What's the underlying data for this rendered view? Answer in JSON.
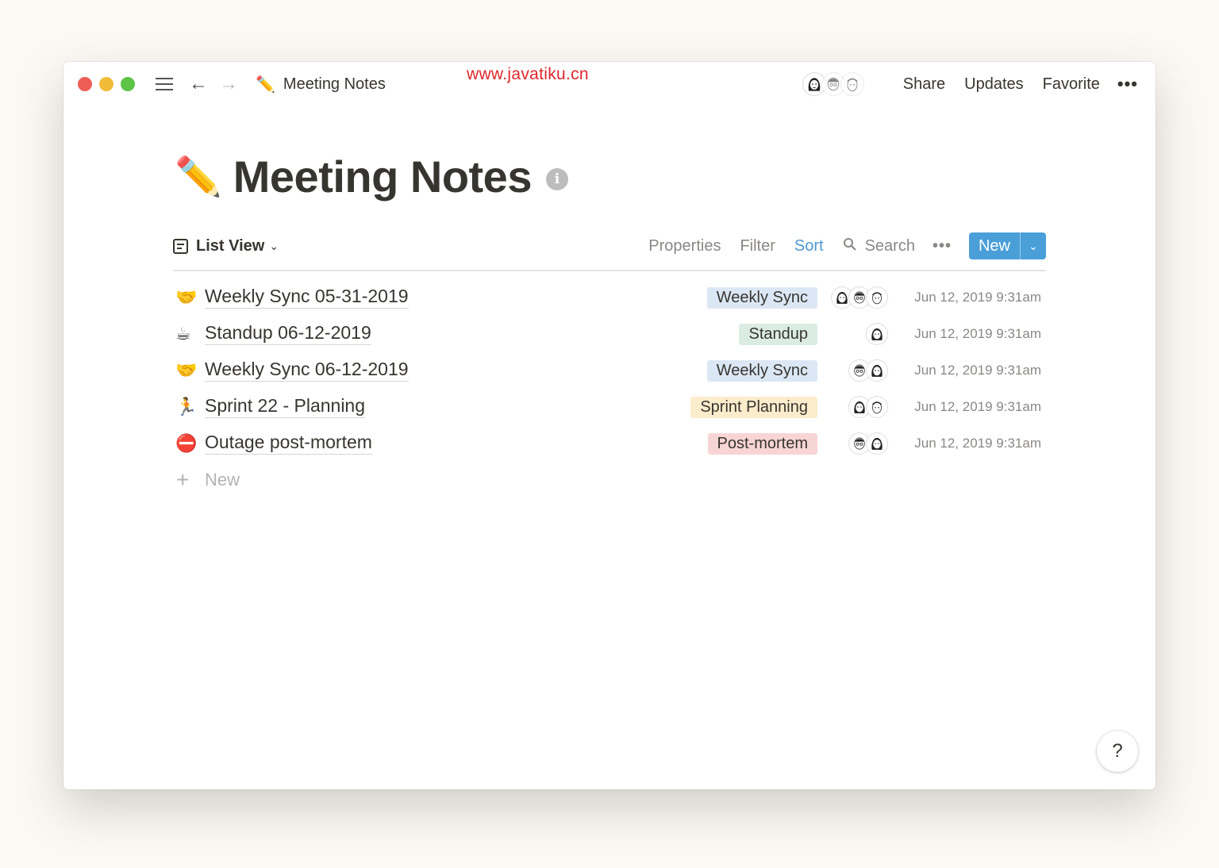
{
  "watermark": "www.javatiku.cn",
  "titlebar": {
    "page_emoji": "✏️",
    "page_name": "Meeting Notes",
    "share": "Share",
    "updates": "Updates",
    "favorite": "Favorite",
    "more": "•••"
  },
  "page": {
    "emoji": "✏️",
    "title": "Meeting Notes",
    "info": "i"
  },
  "view": {
    "name": "List View",
    "properties": "Properties",
    "filter": "Filter",
    "sort": "Sort",
    "search": "Search",
    "more": "•••",
    "new": "New"
  },
  "rows": [
    {
      "emoji": "🤝",
      "title": "Weekly Sync 05-31-2019",
      "tag": "Weekly Sync",
      "tag_color": "#dce7f5",
      "people": 3,
      "date": "Jun 12, 2019 9:31am"
    },
    {
      "emoji": "☕",
      "title": "Standup 06-12-2019",
      "tag": "Standup",
      "tag_color": "#dbece3",
      "people": 1,
      "date": "Jun 12, 2019 9:31am"
    },
    {
      "emoji": "🤝",
      "title": "Weekly Sync 06-12-2019",
      "tag": "Weekly Sync",
      "tag_color": "#dce7f5",
      "people": 2,
      "date": "Jun 12, 2019 9:31am"
    },
    {
      "emoji": "🏃",
      "title": "Sprint 22 - Planning",
      "tag": "Sprint Planning",
      "tag_color": "#fbeccc",
      "people": 2,
      "date": "Jun 12, 2019 9:31am"
    },
    {
      "emoji": "⛔",
      "title": "Outage post-mortem",
      "tag": "Post-mortem",
      "tag_color": "#f8d5d5",
      "people": 2,
      "date": "Jun 12, 2019 9:31am"
    }
  ],
  "new_row": {
    "plus": "+",
    "label": "New"
  },
  "help": "?",
  "colors": {
    "accent": "#4a9fd8",
    "sort_active": "#4e97d2",
    "watermark": "#e0262b"
  }
}
